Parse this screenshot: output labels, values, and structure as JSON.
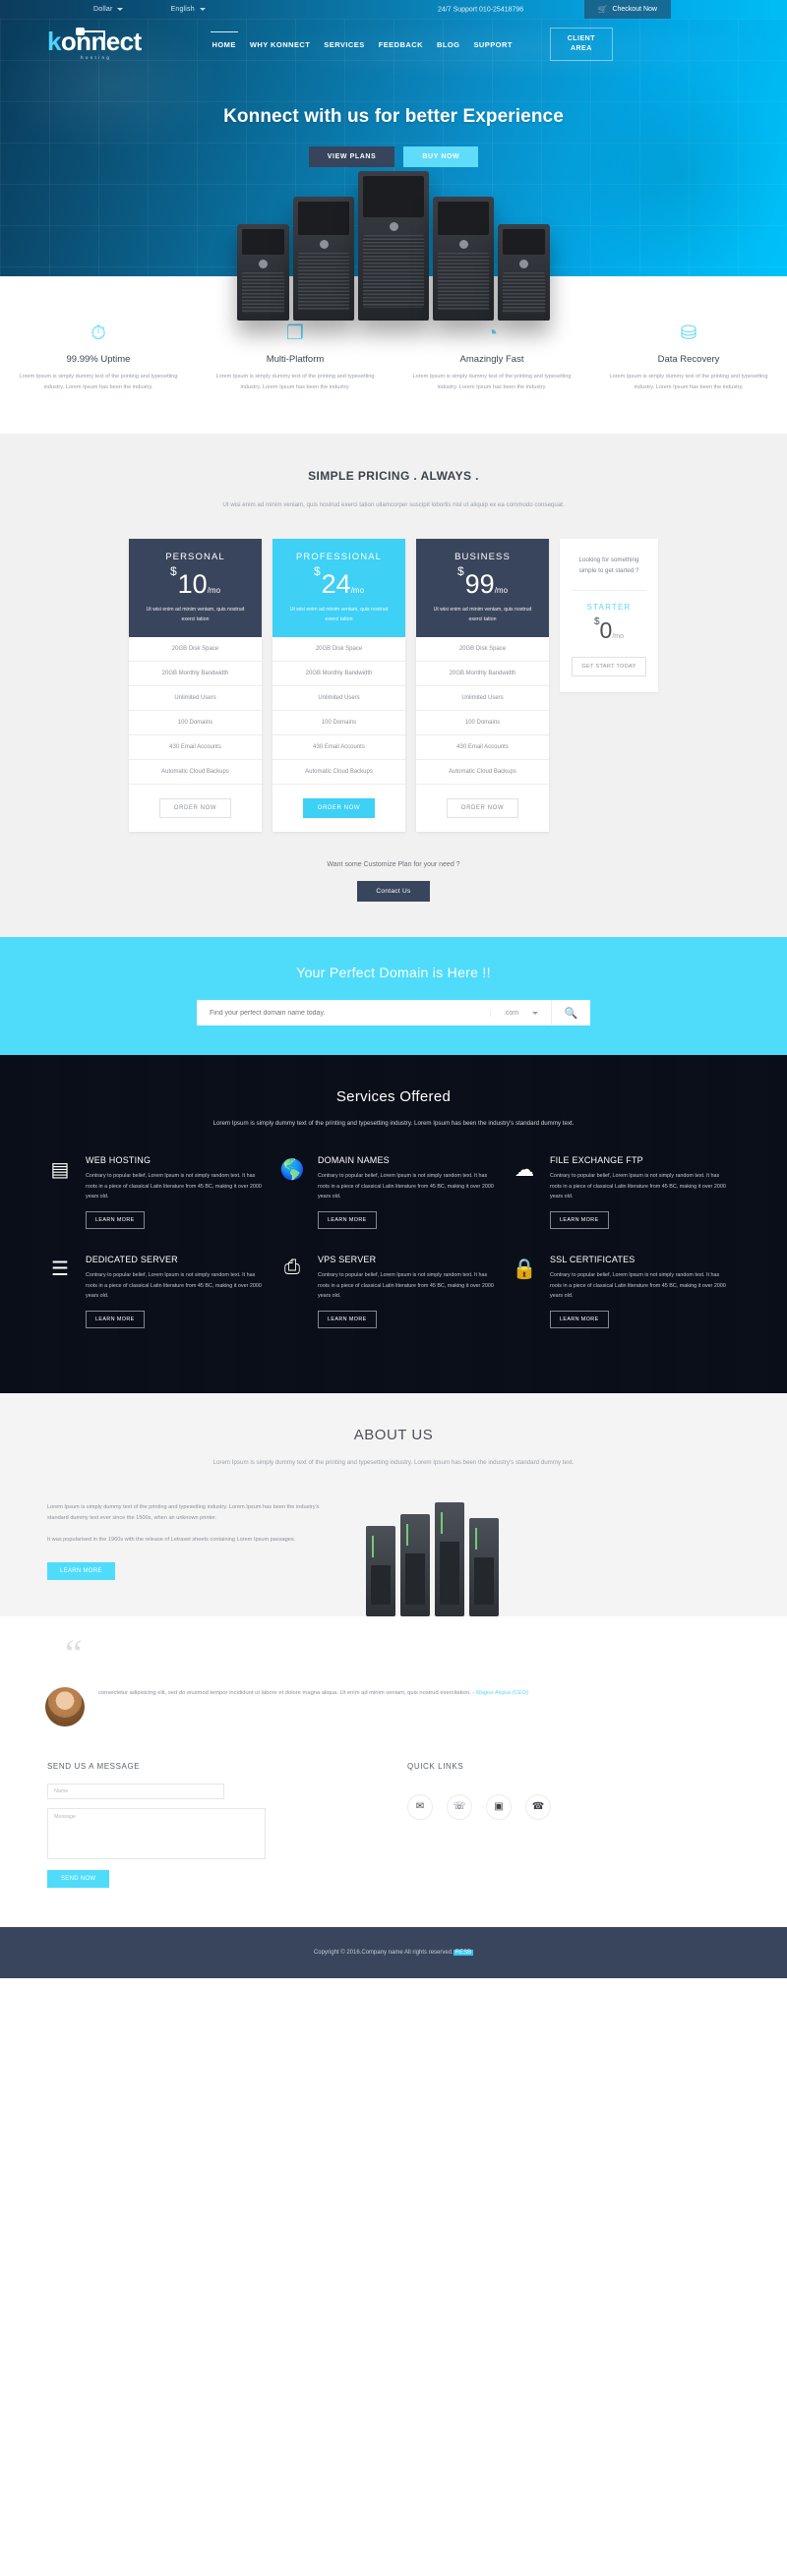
{
  "topbar": {
    "currency": "Dollar",
    "language": "English",
    "support": "24/7 Support 010-25418796",
    "checkout": "Checkout Now",
    "cart_icon": "cart-icon"
  },
  "header": {
    "logo_k": "k",
    "logo_rest": "onnect",
    "logo_tagline": "hosting",
    "nav": [
      {
        "label": "HOME",
        "active": true
      },
      {
        "label": "WHY KONNECT",
        "active": false
      },
      {
        "label": "SERVICES",
        "active": false
      },
      {
        "label": "FEEDBACK",
        "active": false
      },
      {
        "label": "BLOG",
        "active": false
      },
      {
        "label": "SUPPORT",
        "active": false
      }
    ],
    "client_area_line1": "CLIENT",
    "client_area_line2": "AREA"
  },
  "hero": {
    "title": "Konnect with us for better Experience",
    "btn_primary": "VIEW PLANS",
    "btn_secondary": "BUY NOW"
  },
  "features": [
    {
      "icon": "stopwatch-icon",
      "glyph": "⏱",
      "title": "99.99% Uptime",
      "text": "Lorem Ipsum is simply dummy text of the printing and typesetting industry. Lorem Ipsum has been the industry."
    },
    {
      "icon": "window-platform-icon",
      "glyph": "❐",
      "title": "Multi-Platform",
      "text": "Lorem Ipsum is simply dummy text of the printing and typesetting industry. Lorem Ipsum has been the industry."
    },
    {
      "icon": "speedometer-icon",
      "glyph": "◔",
      "title": "Amazingly Fast",
      "text": "Lorem Ipsum is simply dummy text of the printing and typesetting industry. Lorem Ipsum has been the industry."
    },
    {
      "icon": "database-icon",
      "glyph": "⛁",
      "title": "Data Recovery",
      "text": "Lorem Ipsum is simply dummy text of the printing and typesetting industry. Lorem Ipsum has been the industry."
    }
  ],
  "pricing": {
    "title": "SIMPLE PRICING . ALWAYS .",
    "subtitle": "Ut wisi enim ad minim veniam, quis nostrud exerci tation ullamcorper suscipit lobortis nisl ut aliquip ex ea commodo consequat.",
    "plans": [
      {
        "name": "PERSONAL",
        "currency": "$",
        "amount": "10",
        "period": "/mo",
        "desc": "Ut wisi enim ad minim veniam, quis nostrud exerci tation",
        "features": [
          "20GB Disk Space",
          "20GB Monthly Bandwidth",
          "Unlimited Users",
          "100 Domains",
          "430 Email Accounts",
          "Automatic Cloud Backups"
        ],
        "cta": "ORDER NOW",
        "style": "dark"
      },
      {
        "name": "PROFESSIONAL",
        "currency": "$",
        "amount": "24",
        "period": "/mo",
        "desc": "Ut wisi enim ad minim veniam, quis nostrud exerci tation",
        "features": [
          "20GB Disk Space",
          "20GB Monthly Bandwidth",
          "Unlimited Users",
          "100 Domains",
          "430 Email Accounts",
          "Automatic Cloud Backups"
        ],
        "cta": "ORDER NOW",
        "style": "cyan"
      },
      {
        "name": "BUSINESS",
        "currency": "$",
        "amount": "99",
        "period": "/mo",
        "desc": "Ut wisi enim ad minim veniam, quis nostrud exerci tation",
        "features": [
          "20GB Disk Space",
          "20GB Monthly Bandwidth",
          "Unlimited Users",
          "100 Domains",
          "430 Email Accounts",
          "Automatic Cloud Backups"
        ],
        "cta": "ORDER NOW",
        "style": "dark"
      }
    ],
    "starter": {
      "question": "Looking for something simple to get started ?",
      "name": "STARTER",
      "currency": "$",
      "amount": "0",
      "period": "/mo",
      "cta": "GET START TODAY"
    },
    "custom_text": "Want some Customize Plan for your need ?",
    "custom_cta": "Contact Us"
  },
  "domain": {
    "title": "Your Perfect Domain is Here !!",
    "placeholder": "Find your perfect domain name today.",
    "tld": ".com",
    "search_icon": "search-icon"
  },
  "services": {
    "title": "Services Offered",
    "intro": "Lorem Ipsum is simply dummy text of the printing and typesetting industry. Lorem Ipsum has been the industry's standard dummy text.",
    "items": [
      {
        "icon": "server-icon",
        "glyph": "⌸",
        "title": "WEB HOSTING",
        "text": "Contrary to popular belief, Lorem Ipsum is not simply random text. It has roots in a piece of classical Latin literature from 45 BC, making it over 2000 years old.",
        "cta": "LEARN MORE"
      },
      {
        "icon": "globe-www-icon",
        "glyph": "ἱ0",
        "title": "DOMAIN NAMES",
        "text": "Contrary to popular belief, Lorem Ipsum is not simply random text. It has roots in a piece of classical Latin literature from 45 BC, making it over 2000 years old.",
        "cta": "LEARN MORE"
      },
      {
        "icon": "cloud-exchange-icon",
        "glyph": "☁",
        "title": "FILE EXCHANGE FTP",
        "text": "Contrary to popular belief, Lorem Ipsum is not simply random text. It has roots in a piece of classical Latin literature from 45 BC, making it over 2000 years old.",
        "cta": "LEARN MORE"
      },
      {
        "icon": "rack-server-icon",
        "glyph": "☰",
        "title": "DEDICATED SERVER",
        "text": "Contrary to popular belief, Lorem Ipsum is not simply random text. It has roots in a piece of classical Latin literature from 45 BC, making it over 2000 years old.",
        "cta": "LEARN MORE"
      },
      {
        "icon": "vps-tower-icon",
        "glyph": "⎙",
        "title": "VPS SERVER",
        "text": "Contrary to popular belief, Lorem Ipsum is not simply random text. It has roots in a piece of classical Latin literature from 45 BC, making it over 2000 years old.",
        "cta": "LEARN MORE"
      },
      {
        "icon": "lock-icon",
        "glyph": "🔒",
        "title": "SSL CERTIFICATES",
        "text": "Contrary to popular belief, Lorem Ipsum is not simply random text. It has roots in a piece of classical Latin literature from 45 BC, making it over 2000 years old.",
        "cta": "LEARN MORE"
      }
    ]
  },
  "about": {
    "title": "ABOUT US",
    "intro": "Lorem Ipsum is simply dummy text of the printing and typesetting industry. Lorem Ipsum has been the industry's standard dummy text.",
    "p1": "Lorem Ipsum is simply dummy text of the printing and typesetting industry. Lorem Ipsum has been the industry's standard dummy text ever since the 1500s, when an unknown printer.",
    "p2": "It was popularised in the 1960s with the release of Letraset sheets containing Lorem Ipsum passages.",
    "cta": "LEARN MORE"
  },
  "testimonial": {
    "quote_mark": "“",
    "text": "consectetur adipisicing elit, sed do eiusmod tempor incididunt ut labore et dolore magna aliqua. Ut enim ad minim veniam, quis nostrud exercitation. - ",
    "author": "Magna Aliqua (CEO)",
    "avatar": "avatar"
  },
  "contact": {
    "form_title": "SEND US A MESSAGE",
    "name_placeholder": "Name",
    "message_placeholder": "Message",
    "send_label": "SEND NOW",
    "quick_links_title": "QUICK LINKS",
    "links": [
      {
        "icon": "envelope-icon",
        "glyph": "✉"
      },
      {
        "icon": "user-card-icon",
        "glyph": "☍"
      },
      {
        "icon": "image-icon",
        "glyph": "▣"
      },
      {
        "icon": "phone-icon",
        "glyph": "☎"
      }
    ]
  },
  "footer": {
    "copyright": "Copyright © 2016.Company name All rights reserved.",
    "highlight": "RESB"
  },
  "colors": {
    "accent_cyan": "#4fdcfb",
    "dark_navy": "#39455c",
    "hero_blue": "#0a8cc6"
  }
}
